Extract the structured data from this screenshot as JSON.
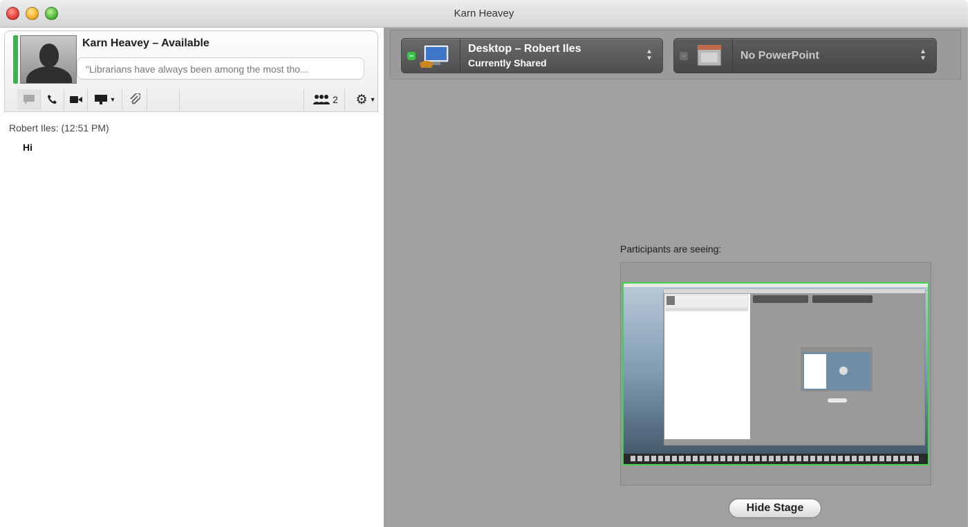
{
  "window": {
    "title": "Karn Heavey"
  },
  "contact": {
    "name": "Karn Heavey",
    "separator": " – ",
    "status": "Available",
    "status_message": "\"Librarians have always been among the most tho...",
    "presence_color": "#39b54a"
  },
  "toolbar": {
    "participants_count": "2",
    "icons": [
      "chat-icon",
      "phone-icon",
      "video-icon",
      "present-icon",
      "attach-icon",
      "participants-icon",
      "gear-icon"
    ]
  },
  "chat": {
    "header": "Robert Iles: (12:51 PM)",
    "message": "Hi"
  },
  "stage": {
    "desktop_selector": {
      "title": "Desktop – Robert Iles",
      "subtitle": "Currently Shared"
    },
    "powerpoint_selector": {
      "title": "No PowerPoint"
    },
    "participants_label": "Participants are seeing:",
    "hide_stage_label": "Hide Stage",
    "share_border_color": "#3fd44a"
  }
}
